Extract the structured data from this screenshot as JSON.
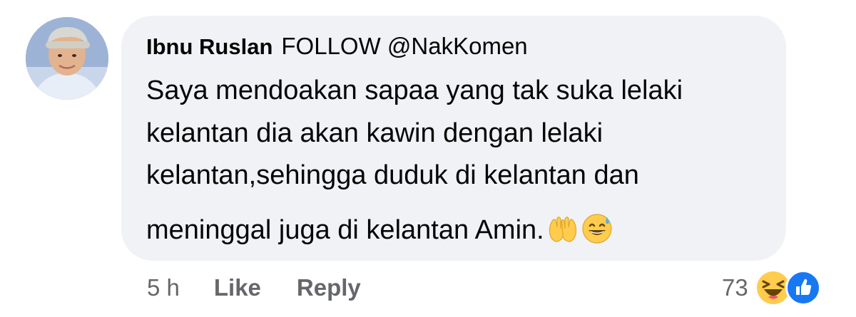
{
  "comment": {
    "author": "Ibnu Ruslan",
    "author_suffix": "FOLLOW @NakKomen",
    "lines": [
      "Saya mendoakan sapaa yang tak suka lelaki",
      "kelantan dia akan kawin dengan lelaki",
      "kelantan,sehingga duduk di kelantan dan",
      "meninggal juga di kelantan Amin."
    ],
    "emojis": [
      "raising-hands-icon",
      "grinning-sweat-icon"
    ]
  },
  "actions": {
    "time": "5 h",
    "like_label": "Like",
    "reply_label": "Reply"
  },
  "reactions": {
    "count": "73",
    "icons": [
      "haha-reaction-icon",
      "like-reaction-icon"
    ]
  },
  "colors": {
    "bubble": "#f0f2f5",
    "text": "#050505",
    "muted": "#65676b",
    "like_blue": "#1877f2",
    "emoji_yellow": "#ffcc4d"
  }
}
